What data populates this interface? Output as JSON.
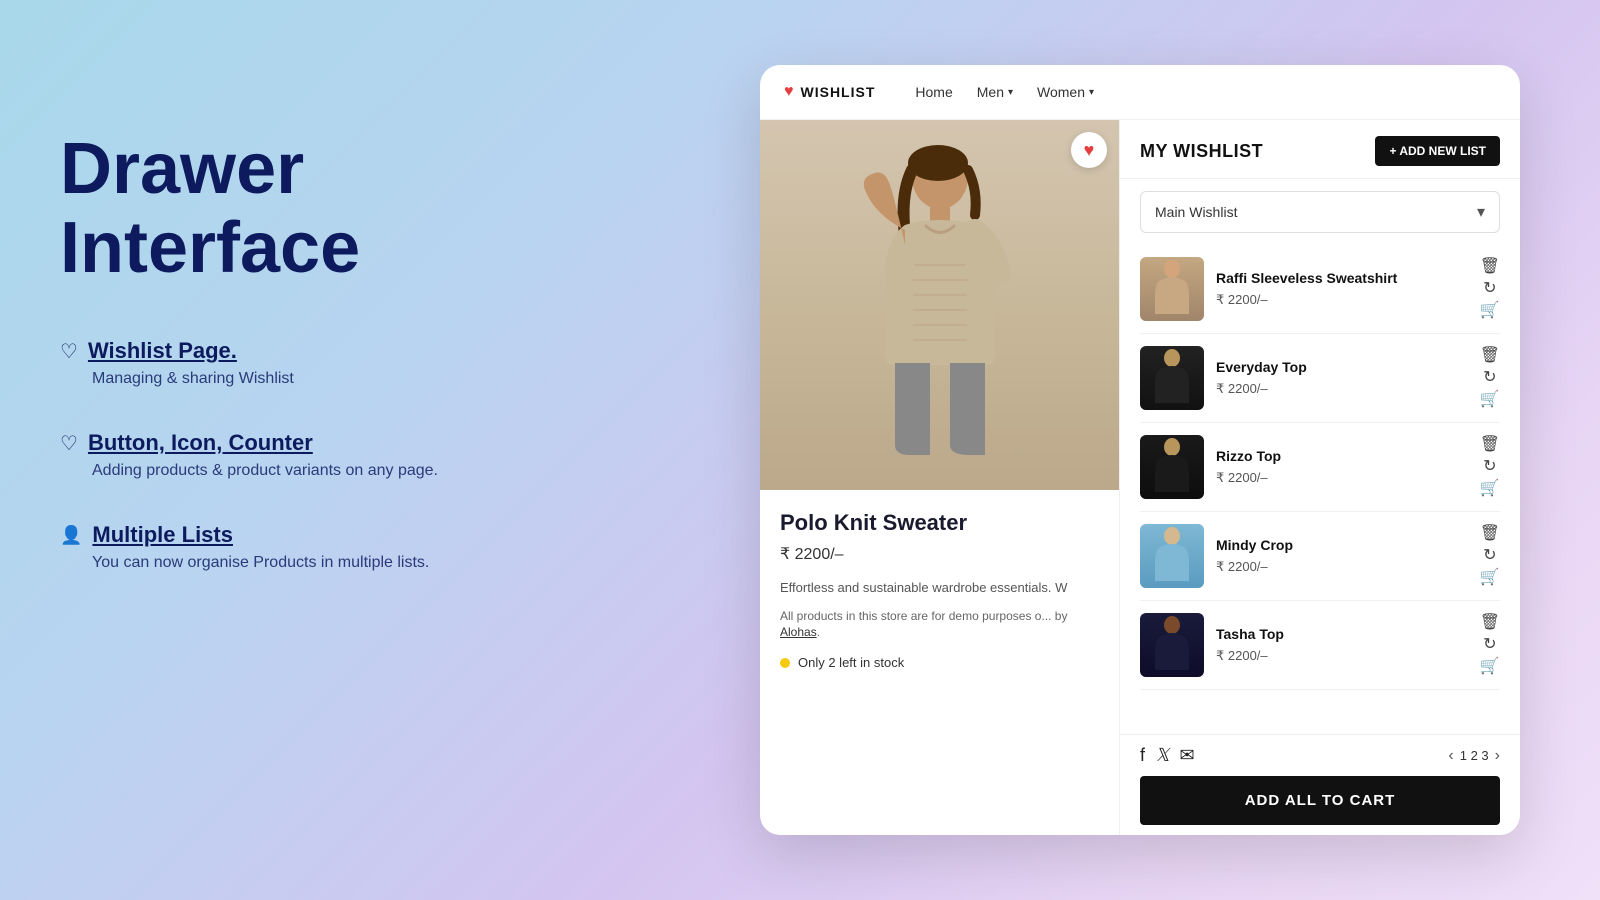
{
  "background": {
    "gradient": "linear-gradient(135deg, #a8d8ea, #d4c5f0, #f0e0f8)"
  },
  "left_panel": {
    "title": "Drawer Interface",
    "features": [
      {
        "icon": "heart",
        "title": "Wishlist Page.",
        "description": "Managing & sharing Wishlist"
      },
      {
        "icon": "heart",
        "title": "Button, Icon, Counter",
        "description": "Adding products & product variants on any page."
      },
      {
        "icon": "user",
        "title": "Multiple Lists",
        "description": "You can now organise Products in multiple lists."
      }
    ]
  },
  "navbar": {
    "logo_text": "WISHLIST",
    "links": [
      {
        "label": "Home",
        "has_dropdown": false
      },
      {
        "label": "Men",
        "has_dropdown": true
      },
      {
        "label": "Women",
        "has_dropdown": true
      }
    ]
  },
  "product": {
    "name": "Polo Knit Sweater",
    "price": "₹ 2200/–",
    "description": "Effortless and sustainable wardrobe essentials. W",
    "demo_note": "All products in this store are for demo purposes o... by Alohas.",
    "stock_text": "Only 2 left in stock",
    "is_wishlisted": true
  },
  "wishlist": {
    "title": "MY WISHLIST",
    "add_new_label": "+ ADD NEW LIST",
    "dropdown_label": "Main Wishlist",
    "items": [
      {
        "name": "Raffi Sleeveless Sweatshirt",
        "price": "₹ 2200/–",
        "thumb_class": "item-thumb-1"
      },
      {
        "name": "Everyday Top",
        "price": "₹ 2200/–",
        "thumb_class": "item-thumb-2"
      },
      {
        "name": "Rizzo Top",
        "price": "₹ 2200/–",
        "thumb_class": "item-thumb-3"
      },
      {
        "name": "Mindy Crop",
        "price": "₹ 2200/–",
        "thumb_class": "item-thumb-4"
      },
      {
        "name": "Tasha Top",
        "price": "₹ 2200/–",
        "thumb_class": "item-thumb-5"
      }
    ],
    "pagination": {
      "current_pages": "1 2 3"
    },
    "add_all_label": "ADD ALL TO  CART",
    "social": [
      "facebook",
      "twitter",
      "email"
    ]
  }
}
